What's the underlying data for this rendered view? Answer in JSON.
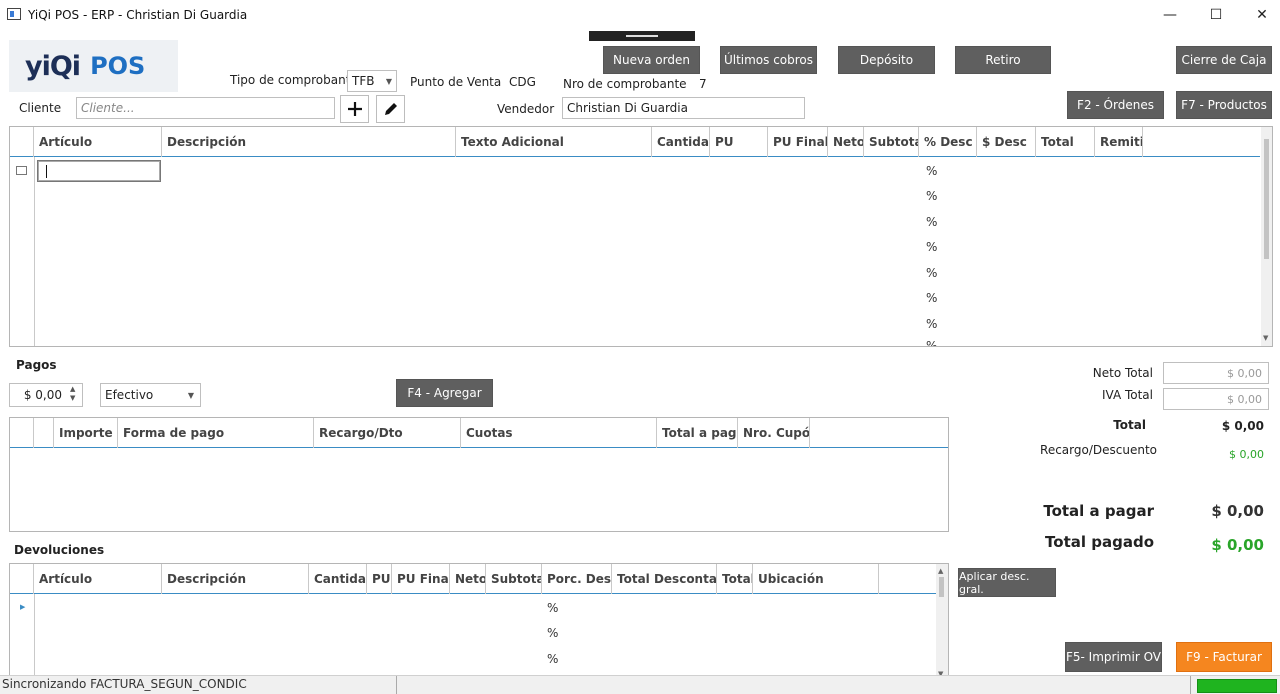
{
  "window": {
    "title": "YiQi POS - ERP - Christian Di Guardia",
    "minimize_glyph": "—",
    "maximize_glyph": "☐",
    "close_glyph": "✕"
  },
  "logo": {
    "part1": "yiQi",
    "part2": "POS"
  },
  "header": {
    "tipo_label": "Tipo de comprobante",
    "tipo_value": "TFB",
    "punto_label": "Punto de Venta",
    "punto_value": "CDG",
    "nro_label": "Nro de comprobante",
    "nro_value": "7",
    "cliente_label": "Cliente",
    "cliente_placeholder": "Cliente...",
    "vendedor_label": "Vendedor",
    "vendedor_value": "Christian Di Guardia"
  },
  "toolbar": {
    "nueva_orden": "Nueva orden",
    "ultimos_cobros": "Últimos cobros",
    "deposito": "Depósito",
    "retiro": "Retiro",
    "cierre_caja": "Cierre de Caja",
    "f2_ordenes": "F2 - Órdenes",
    "f7_productos": "F7 - Productos"
  },
  "items_grid": {
    "columns": [
      "Artículo",
      "Descripción",
      "Texto Adicional",
      "Cantidad",
      "PU",
      "PU Final",
      "Neto",
      "Subtotal",
      "% Desc",
      "$ Desc",
      "Total",
      "Remitir"
    ],
    "pct_symbol": "%"
  },
  "pagos": {
    "title": "Pagos",
    "amount": "$ 0,00",
    "method": "Efectivo",
    "agregar": "F4 - Agregar",
    "columns": [
      "Importe",
      "Forma de pago",
      "Recargo/Dto",
      "Cuotas",
      "Total a pagar",
      "Nro. Cupón"
    ]
  },
  "devoluciones": {
    "title": "Devoluciones",
    "columns": [
      "Artículo",
      "Descripción",
      "Cantidad",
      "PU",
      "PU Final",
      "Neto",
      "Subtotal",
      "Porc. Desc.",
      "Total Descontado",
      "Total",
      "Ubicación"
    ],
    "pct_symbol": "%"
  },
  "totals": {
    "neto_total_label": "Neto Total",
    "neto_total_value": "$ 0,00",
    "iva_total_label": "IVA Total",
    "iva_total_value": "$ 0,00",
    "total_label": "Total",
    "total_value": "$ 0,00",
    "recargo_label": "Recargo/Descuento",
    "recargo_value": "$ 0,00",
    "total_a_pagar_label": "Total a pagar",
    "total_a_pagar_value": "$ 0,00",
    "total_pagado_label": "Total pagado",
    "total_pagado_value": "$ 0,00"
  },
  "actions": {
    "aplicar_desc": "Aplicar desc. gral.",
    "imprimir_ov": "F5- Imprimir OV",
    "facturar": "F9 - Facturar"
  },
  "status": {
    "text": "Sincronizando FACTURA_SEGUN_CONDIC"
  },
  "colors": {
    "button_dark": "#5f5f5f",
    "accent_orange": "#f5861f",
    "accent_blue": "#3a8cc4",
    "green": "#2aa52a"
  }
}
